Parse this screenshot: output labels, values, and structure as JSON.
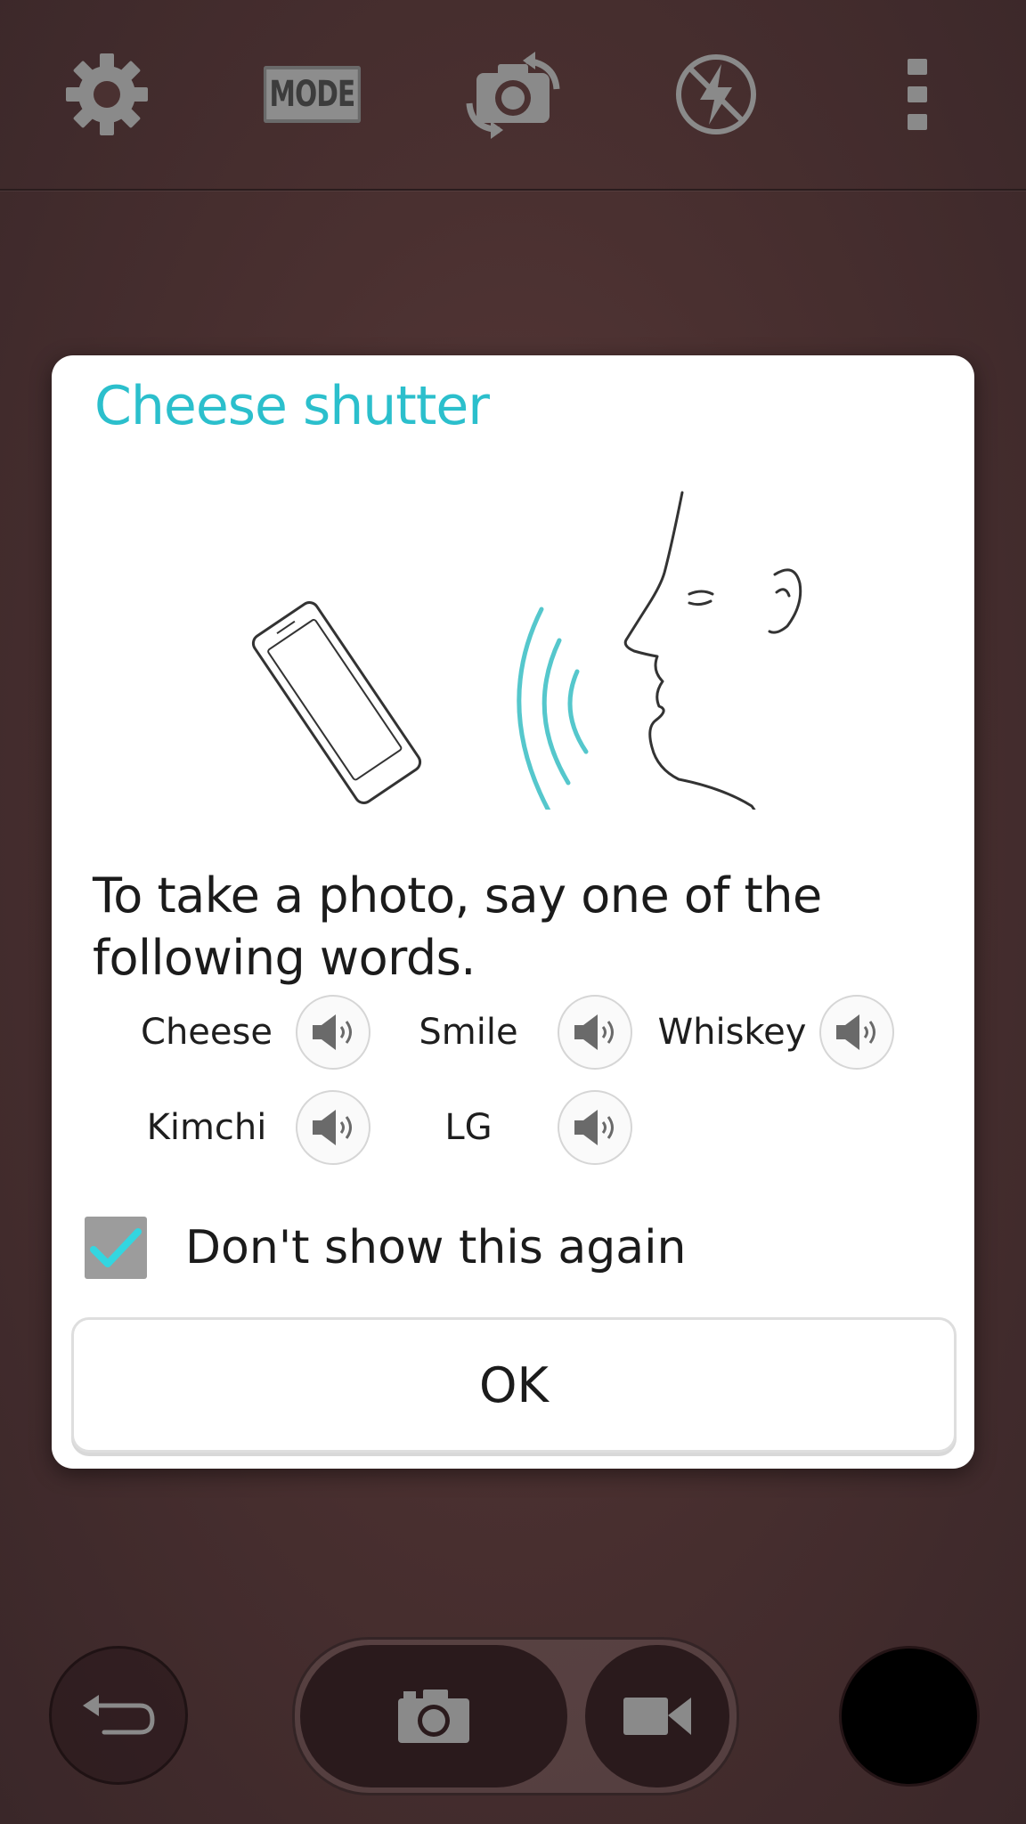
{
  "top_bar": {
    "mode_label": "MODE",
    "icons": [
      "gear-icon",
      "mode-icon",
      "switch-camera-icon",
      "flash-off-icon",
      "more-vert-icon"
    ]
  },
  "dialog": {
    "title": "Cheese shutter",
    "instructions": "To take a photo, say one of the following words.",
    "words": [
      "Cheese",
      "Smile",
      "Whiskey",
      "Kimchi",
      "LG"
    ],
    "checkbox_label": "Don't show this again",
    "checkbox_checked": true,
    "ok_label": "OK",
    "accent_color": "#2bbfcc"
  },
  "bottom_bar": {
    "icons": [
      "back-icon",
      "camera-icon",
      "video-icon"
    ]
  }
}
